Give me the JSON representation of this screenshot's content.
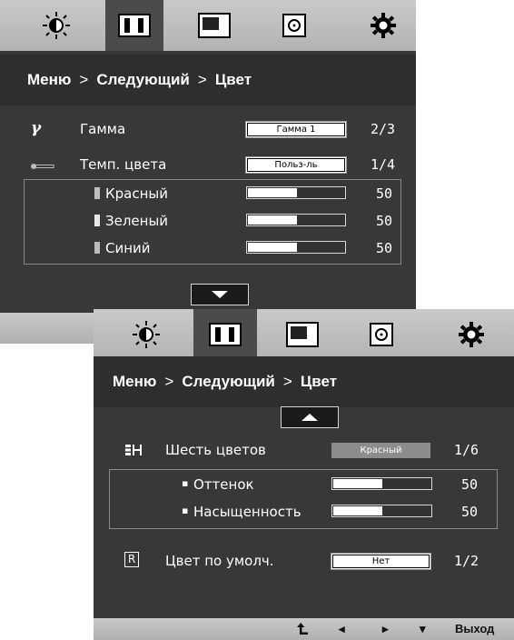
{
  "tabs": [
    {
      "icon": "brightness-icon"
    },
    {
      "icon": "picture-icon"
    },
    {
      "icon": "screen-position-icon"
    },
    {
      "icon": "sound-disc-icon"
    },
    {
      "icon": "settings-gear-icon"
    }
  ],
  "panel1": {
    "breadcrumb": {
      "menu": "Меню",
      "sep1": ">",
      "next": "Следующий",
      "sep2": ">",
      "current": "Цвет"
    },
    "gamma": {
      "icon": "gamma-icon",
      "label": "Гамма",
      "value": "Гамма 1",
      "index": "2/3"
    },
    "color_temp": {
      "icon": "thermometer-icon",
      "label": "Темп. цвета",
      "value": "Польз-ль",
      "index": "1/4"
    },
    "red": {
      "label": "Красный",
      "value": "50",
      "level": 0.5
    },
    "green": {
      "label": "Зеленый",
      "value": "50",
      "level": 0.5
    },
    "blue": {
      "label": "Синий",
      "value": "50",
      "level": 0.5
    },
    "down_button": "down-arrow-icon"
  },
  "panel2": {
    "breadcrumb": {
      "menu": "Меню",
      "sep1": ">",
      "next": "Следующий",
      "sep2": ">",
      "current": "Цвет"
    },
    "up_button": "up-arrow-icon",
    "six_colors": {
      "icon": "six-color-icon",
      "label": "Шесть цветов",
      "value": "Красный",
      "index": "1/6"
    },
    "hue": {
      "bullet": "▪",
      "label": "Оттенок",
      "value": "50",
      "level": 0.5
    },
    "saturation": {
      "bullet": "▪",
      "label": "Насыщенность",
      "value": "50",
      "level": 0.5
    },
    "reset": {
      "icon": "R",
      "label": "Цвет по умолч.",
      "value": "Нет",
      "index": "1/2"
    },
    "nav": {
      "back": "back-arrow-icon",
      "left": "◂",
      "right": "▸",
      "down": "▾",
      "exit": "Выход"
    }
  },
  "colors": {
    "osd_bg": "#383838",
    "bar_bg": "#bcbcbc",
    "active_tab": "#4b4b4b"
  }
}
